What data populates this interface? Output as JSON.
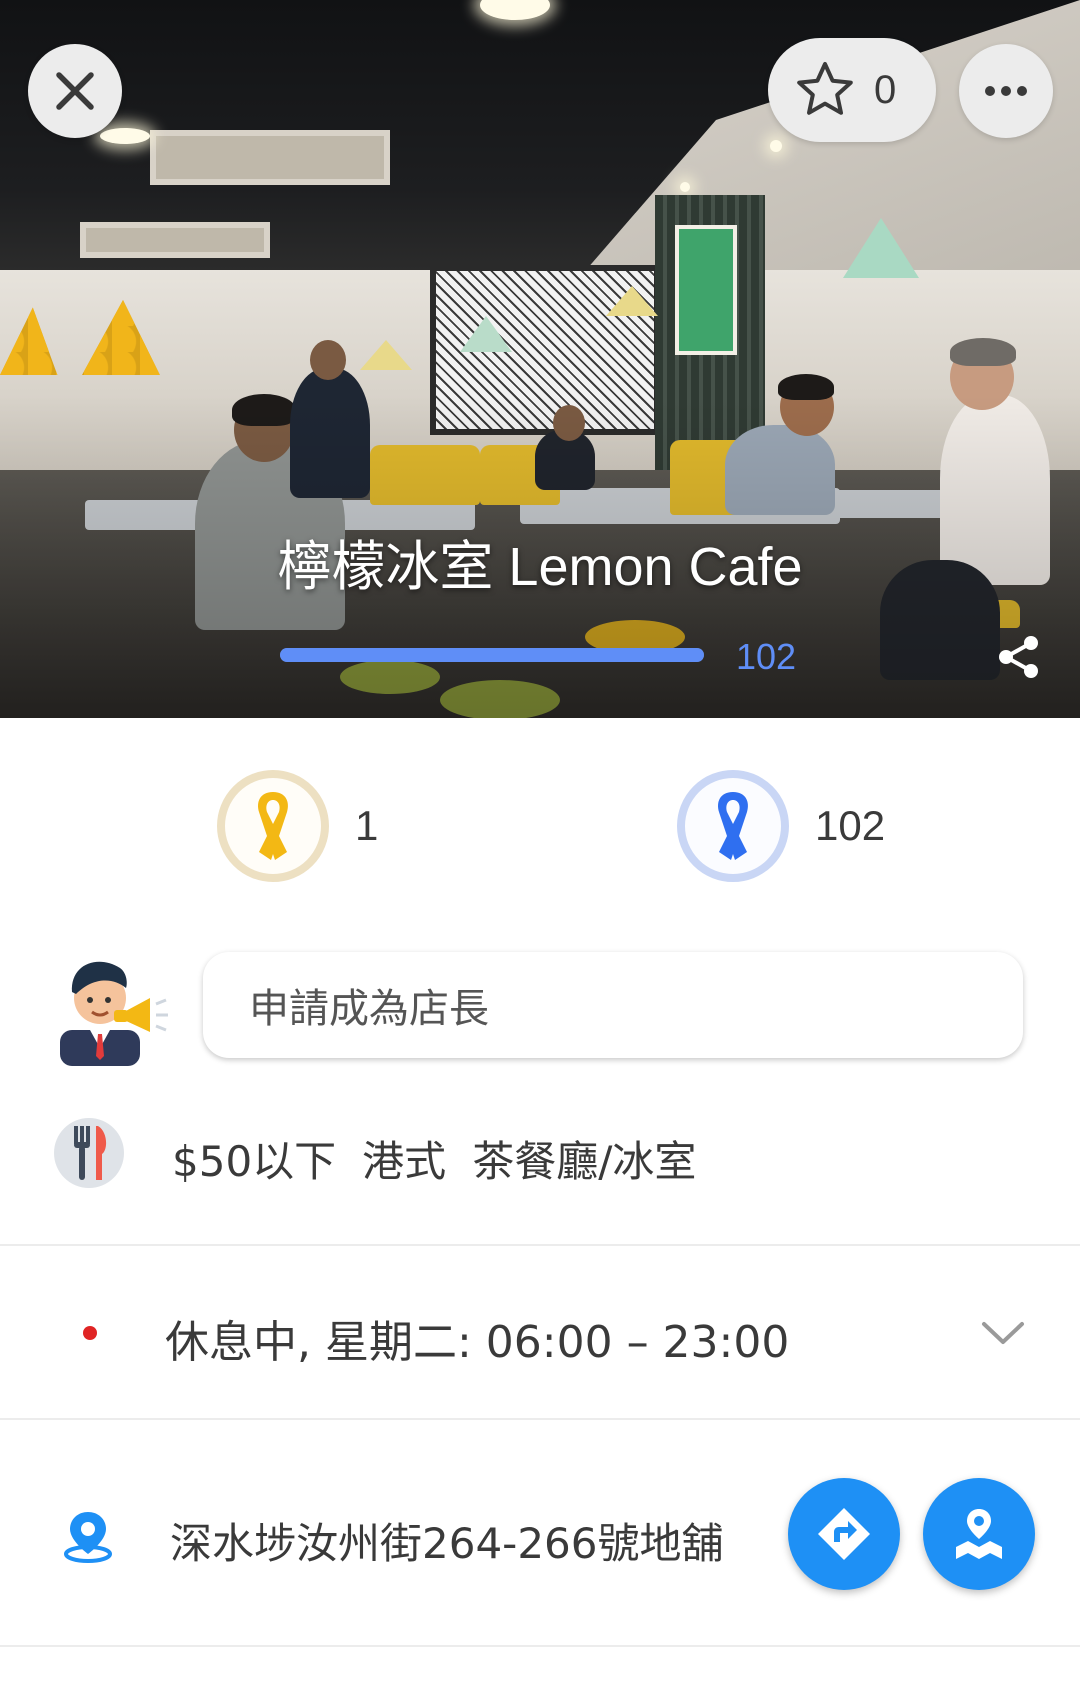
{
  "header": {
    "close_icon": "close-icon",
    "favorite_icon": "star-outline-icon",
    "favorite_count": "0",
    "more_icon": "more-horizontal-icon"
  },
  "hero": {
    "title": "檸檬冰室 Lemon Cafe",
    "progress_count": "102",
    "progress_fraction": 1.0,
    "share_icon": "share-icon"
  },
  "ribbons": {
    "yellow": {
      "icon": "yellow-ribbon-icon",
      "count": "1",
      "color": "#f3b814"
    },
    "blue": {
      "icon": "blue-ribbon-icon",
      "count": "102",
      "color": "#2f6ff0"
    }
  },
  "owner": {
    "avatar_icon": "manager-megaphone-icon",
    "apply_placeholder": "申請成為店長"
  },
  "info": {
    "category_icon": "utensils-icon",
    "tags": [
      "$50以下",
      "港式",
      "茶餐廳/冰室"
    ],
    "status_color": "#e02424",
    "hours_text": "休息中, 星期二: 06:00 – 23:00",
    "expand_icon": "chevron-down-icon",
    "address_icon": "location-pin-icon",
    "address": "深水埗汝州街264-266號地舖",
    "directions_icon": "directions-icon",
    "map_icon": "map-pin-icon",
    "accent_color": "#1e90f5"
  }
}
